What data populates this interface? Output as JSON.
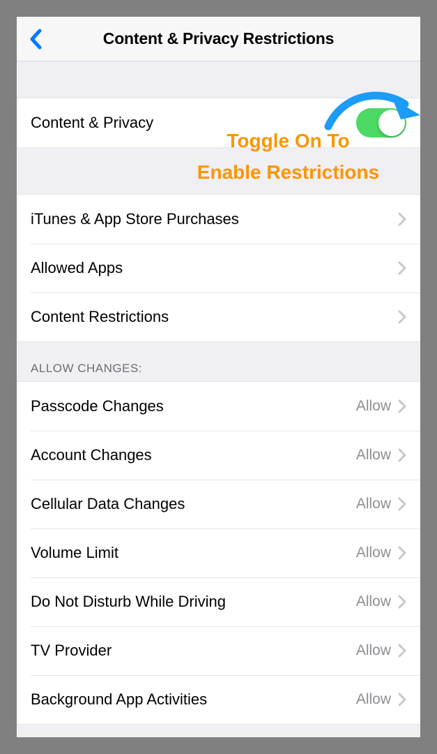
{
  "nav": {
    "title": "Content & Privacy Restrictions"
  },
  "toggle_row": {
    "label": "Content & Privacy",
    "state": "on"
  },
  "annotation": {
    "line1": "Toggle On To",
    "line2": "Enable Restrictions"
  },
  "group1": {
    "items": [
      {
        "label": "iTunes & App Store Purchases"
      },
      {
        "label": "Allowed Apps"
      },
      {
        "label": "Content Restrictions"
      }
    ]
  },
  "section_header": "ALLOW CHANGES:",
  "group2": {
    "items": [
      {
        "label": "Passcode Changes",
        "detail": "Allow"
      },
      {
        "label": "Account Changes",
        "detail": "Allow"
      },
      {
        "label": "Cellular Data Changes",
        "detail": "Allow"
      },
      {
        "label": "Volume Limit",
        "detail": "Allow"
      },
      {
        "label": "Do Not Disturb While Driving",
        "detail": "Allow"
      },
      {
        "label": "TV Provider",
        "detail": "Allow"
      },
      {
        "label": "Background App Activities",
        "detail": "Allow"
      }
    ]
  }
}
